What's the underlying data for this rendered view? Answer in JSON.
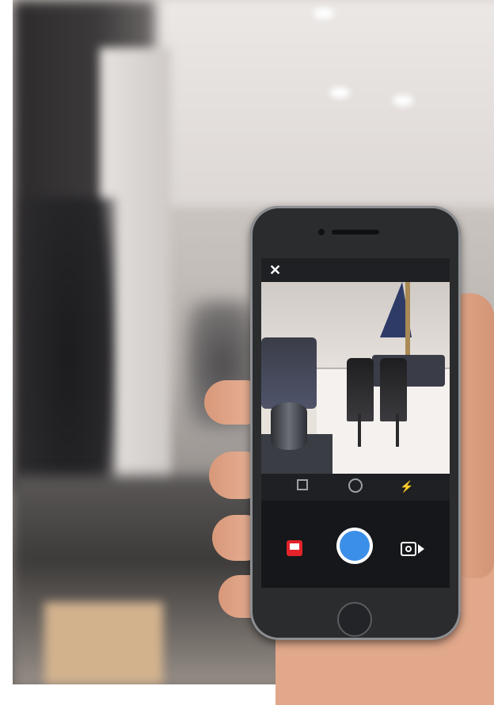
{
  "scene": {
    "description_free": true
  },
  "camera_ui": {
    "close_icon": "close-icon",
    "close_glyph": "✕",
    "toolbar": {
      "grid": "grid-icon",
      "flip": "flip-camera-icon",
      "flash": "flash-icon",
      "flash_glyph": "⚡"
    },
    "controls": {
      "left": "boomerang-icon",
      "shutter": "shutter-button",
      "right": "video-mode-icon"
    },
    "colors": {
      "shutter": "#3b8fe8",
      "boomerang": "#e2232a",
      "ui_background": "#1e2023"
    }
  }
}
